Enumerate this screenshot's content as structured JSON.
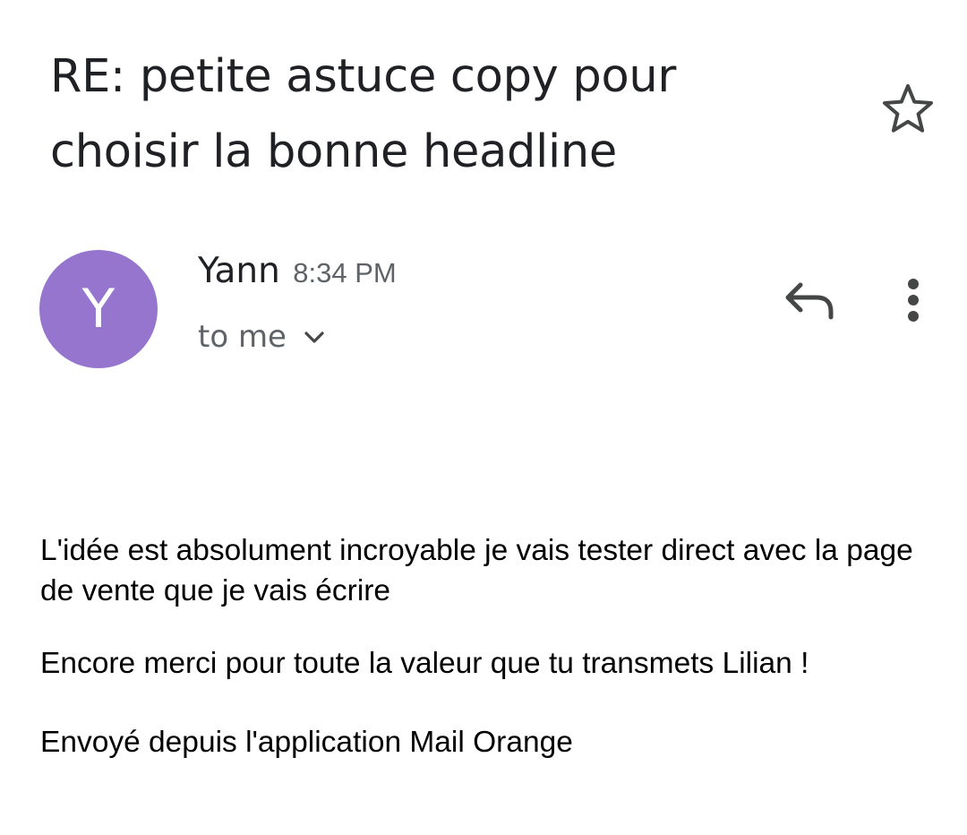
{
  "email": {
    "subject": "RE: petite astuce copy pour choisir la bonne headline",
    "sender": {
      "initial": "Y",
      "name": "Yann",
      "time": "8:34 PM",
      "avatar_color": "#9575cd"
    },
    "recipient_label": "to me",
    "body": {
      "paragraph_1": "L'idée est absolument incroyable je vais tester direct avec la page de vente que je vais écrire",
      "paragraph_2": "Encore merci pour toute la valeur que tu transmets Lilian !",
      "signature": "Envoyé depuis l'application Mail Orange"
    }
  },
  "icons": {
    "star": "star-outline-icon",
    "reply": "reply-arrow-icon",
    "more": "more-vertical-icon",
    "expand": "chevron-down-icon"
  },
  "colors": {
    "text_primary": "#202124",
    "text_secondary": "#5f6368",
    "icon": "#444746"
  }
}
